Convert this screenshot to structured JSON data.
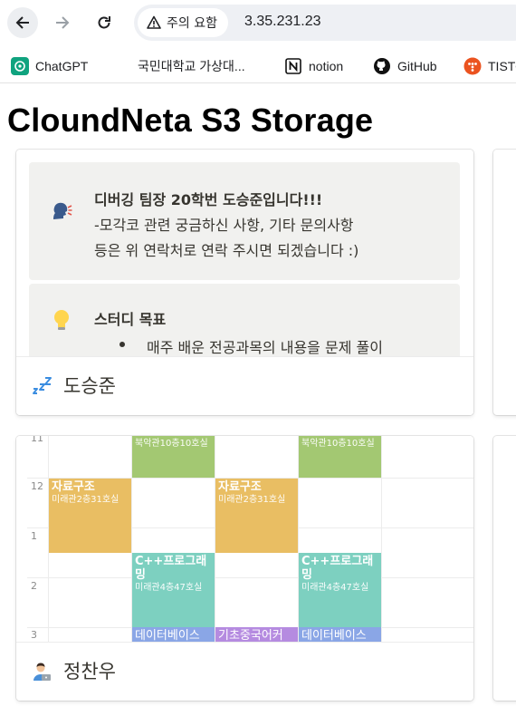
{
  "browser": {
    "security_label": "주의 요함",
    "url": "3.35.231.23",
    "bookmarks": [
      {
        "label": "ChatGPT",
        "icon": "chatgpt-icon"
      },
      {
        "label": "국민대학교 가상대...",
        "icon": "none"
      },
      {
        "label": "notion",
        "icon": "notion-icon"
      },
      {
        "label": "GitHub",
        "icon": "github-icon"
      },
      {
        "label": "TISTO",
        "icon": "tistory-icon"
      }
    ]
  },
  "page": {
    "title": "CloundNeta S3 Storage"
  },
  "cards": [
    {
      "name": "도승준",
      "callout1": {
        "line1": "디버깅 팀장 20학번 도승준입니다!!!",
        "line2": "-모각코 관련 궁금하신 사항, 기타 문의사항",
        "line3": "등은 위 연락처로 연락 주시면 되겠습니다 :)"
      },
      "callout2": {
        "heading": "스터디 목표",
        "bullet": "매주 배운 전공과목의 내용을 문제 풀이"
      }
    },
    {
      "name": "정찬우",
      "timetable": {
        "hours": [
          "11",
          "12",
          "1",
          "2",
          "3"
        ],
        "blocks": [
          {
            "title": "",
            "room": "북악관10층10호실",
            "color": "#a3c872"
          },
          {
            "title": "",
            "room": "북악관10층10호실",
            "color": "#a3c872"
          },
          {
            "title": "자료구조",
            "room": "미래관2층31호실",
            "color": "#e9be63"
          },
          {
            "title": "자료구조",
            "room": "미래관2층31호실",
            "color": "#e9be63"
          },
          {
            "title": "C++프로그래밍",
            "room": "미래관4층47호실",
            "color": "#7dd0c0"
          },
          {
            "title": "C++프로그래밍",
            "room": "미래관4층47호실",
            "color": "#7dd0c0"
          },
          {
            "title": "데이터베이스",
            "room": "",
            "color": "#8aa6e6"
          },
          {
            "title": "기초중국어커",
            "room": "",
            "color": "#b58be0"
          },
          {
            "title": "데이터베이스",
            "room": "",
            "color": "#8aa6e6"
          }
        ]
      }
    }
  ]
}
